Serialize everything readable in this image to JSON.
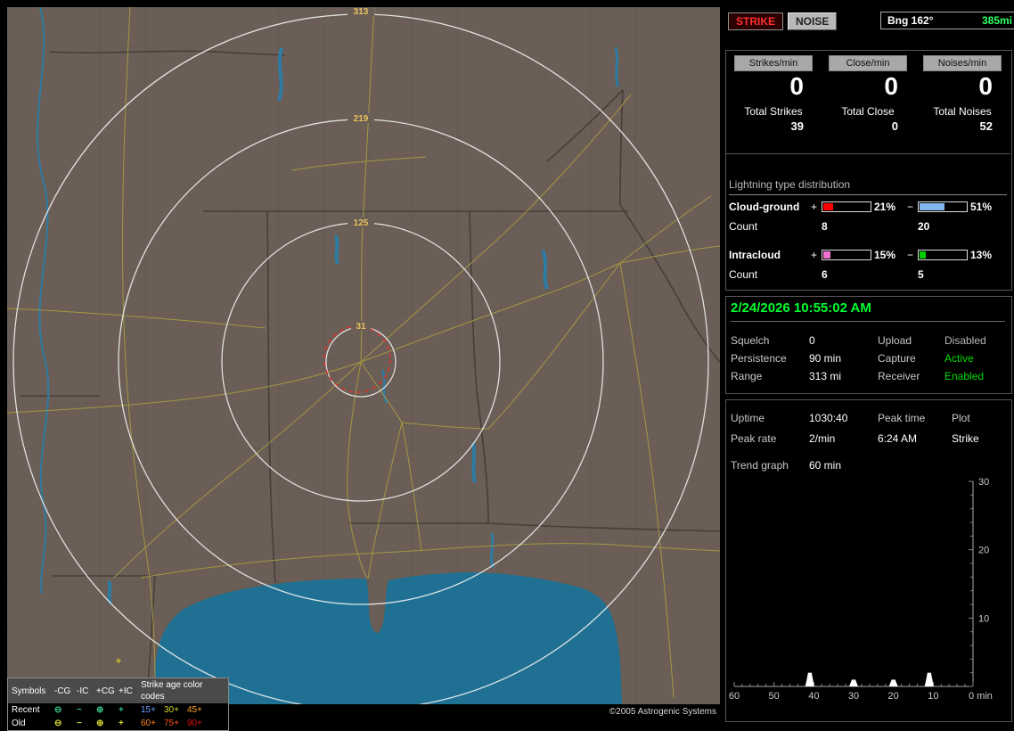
{
  "app": {
    "copyright": "©2005 Astrogenic Systems"
  },
  "map": {
    "rings": [
      {
        "label": "313"
      },
      {
        "label": "219"
      },
      {
        "label": "125"
      },
      {
        "label": "31"
      }
    ],
    "strike_symbol": "+",
    "colors": {
      "land": "#6a5e56",
      "water": "#1f7092",
      "roads": "#b0a040",
      "range_rings": "#f2f2f2",
      "alarm_ring": "#e23030",
      "ring_labels": "#e6c35c"
    }
  },
  "legend": {
    "header_label": "Symbols",
    "columns": [
      "-CG",
      "-IC",
      "+CG",
      "+IC"
    ],
    "age_header": "Strike age color codes",
    "rows": [
      {
        "label": "Recent",
        "symbol_color": "#35c384",
        "symbols": [
          "⊖",
          "−",
          "⊕",
          "+"
        ],
        "ages": [
          {
            "text": "15+",
            "color": "#6b9bff"
          },
          {
            "text": "30+",
            "color": "#d6d630"
          },
          {
            "text": "45+",
            "color": "#ffa030"
          }
        ]
      },
      {
        "label": "Old",
        "symbol_color": "#d6d630",
        "symbols": [
          "⊖",
          "−",
          "⊕",
          "+"
        ],
        "ages": [
          {
            "text": "60+",
            "color": "#ff8820"
          },
          {
            "text": "75+",
            "color": "#ff5010"
          },
          {
            "text": "90+",
            "color": "#e01010"
          }
        ]
      }
    ]
  },
  "panel": {
    "strike_button": "STRIKE",
    "noise_button": "NOISE",
    "bearing_label": "Bng 162°",
    "bearing_range": "385mi",
    "bearing_range_color": "#30ff60",
    "counters": [
      {
        "label": "Strikes/min",
        "value": "0",
        "total_label": "Total Strikes",
        "total": "39"
      },
      {
        "label": "Close/min",
        "value": "0",
        "total_label": "Total Close",
        "total": "0"
      },
      {
        "label": "Noises/min",
        "value": "0",
        "total_label": "Total Noises",
        "total": "52"
      }
    ],
    "distribution": {
      "title": "Lightning type distribution",
      "count_label": "Count",
      "rows": [
        {
          "label": "Cloud-ground",
          "pos_sign": "+",
          "pos_pct": "21%",
          "pos_fill": 21,
          "pos_color": "#ff0000",
          "pos_count": "8",
          "neg_sign": "−",
          "neg_pct": "51%",
          "neg_fill": 51,
          "neg_color": "#82b8f0",
          "neg_count": "20"
        },
        {
          "label": "Intracloud",
          "pos_sign": "+",
          "pos_pct": "15%",
          "pos_fill": 15,
          "pos_color": "#f070d0",
          "pos_count": "6",
          "neg_sign": "−",
          "neg_pct": "13%",
          "neg_fill": 13,
          "neg_color": "#00cc00",
          "neg_count": "5"
        }
      ]
    },
    "timestamp": "2/24/2026 10:55:02 AM",
    "timestamp_color": "#00ff30",
    "settings": [
      {
        "label": "Squelch",
        "value": "0",
        "label2": "Upload",
        "value2": "Disabled",
        "value2_color": "#b8b8b8"
      },
      {
        "label": "Persistence",
        "value": "90 min",
        "label2": "Capture",
        "value2": "Active",
        "value2_color": "#00dd00"
      },
      {
        "label": "Range",
        "value": "313 mi",
        "label2": "Receiver",
        "value2": "Enabled",
        "value2_color": "#00dd00"
      }
    ],
    "stats": {
      "uptime_label": "Uptime",
      "uptime": "1030:40",
      "peak_time_label": "Peak time",
      "peak_time": "6:24 AM",
      "plot_label": "Plot",
      "plot": "Strike",
      "peak_rate_label": "Peak rate",
      "peak_rate": "2/min",
      "trend_label": "Trend graph",
      "trend_window": "60 min"
    }
  },
  "chart_data": {
    "type": "bar",
    "title": "Trend graph",
    "window": "60 min",
    "x_unit_label": "min",
    "x_ticks": [
      60,
      50,
      40,
      30,
      20,
      10
    ],
    "x_end_label": "0 min",
    "y_ticks": [
      30,
      20,
      10
    ],
    "ylim": [
      0,
      30
    ],
    "xlim_minutes_ago": [
      60,
      0
    ],
    "grid": false,
    "legend_position": "none",
    "series": [
      {
        "name": "Strike",
        "points": [
          {
            "minutes_ago": 41,
            "value": 2
          },
          {
            "minutes_ago": 30,
            "value": 1
          },
          {
            "minutes_ago": 20,
            "value": 1
          },
          {
            "minutes_ago": 11,
            "value": 2
          }
        ]
      }
    ]
  }
}
